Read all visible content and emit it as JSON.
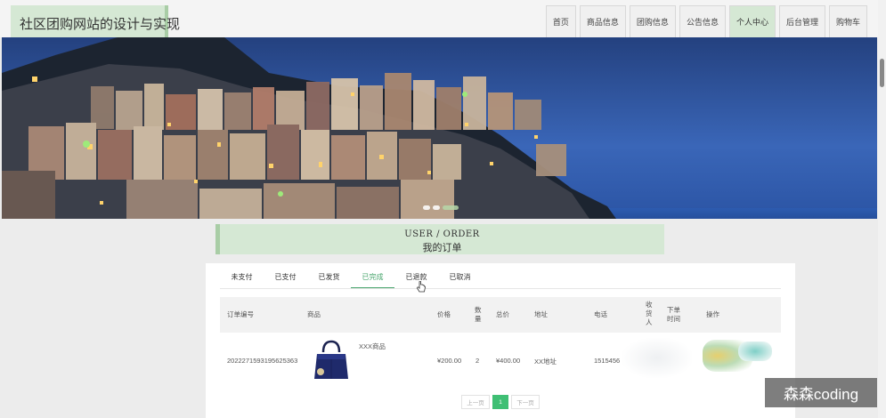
{
  "header": {
    "site_title": "社区团购网站的设计与实现",
    "nav": [
      "首页",
      "商品信息",
      "团购信息",
      "公告信息",
      "个人中心",
      "后台管理",
      "购物车"
    ],
    "active_nav_index": 4,
    "colors": {
      "accent_green": "#d5e8d4",
      "border_green": "#a9cda6"
    }
  },
  "banner": {
    "dot_count": 3,
    "active_dot_index": 2
  },
  "section": {
    "title_en": "USER / ORDER",
    "title_zh": "我的订单"
  },
  "tabs": {
    "items": [
      "未支付",
      "已支付",
      "已发货",
      "已完成",
      "已退款",
      "已取消"
    ],
    "active_index": 3,
    "active_color": "#48a56d"
  },
  "table": {
    "headers": {
      "order_no": "订单编号",
      "product": "商品",
      "price": "价格",
      "qty": "数量",
      "total": "总价",
      "address": "地址",
      "phone": "电话",
      "receiver": "收货人",
      "order_time": "下单时间",
      "action": "操作"
    },
    "rows": [
      {
        "order_no": "2022271593195625363",
        "product_name": "XXX商品",
        "price": "¥200.00",
        "qty": "2",
        "total": "¥400.00",
        "address": "XX地址",
        "phone": "1515456"
      }
    ]
  },
  "pagination": {
    "prev": "上一页",
    "current": "1",
    "next": "下一页",
    "active_color": "#3fbf74"
  },
  "watermark": "森森coding"
}
